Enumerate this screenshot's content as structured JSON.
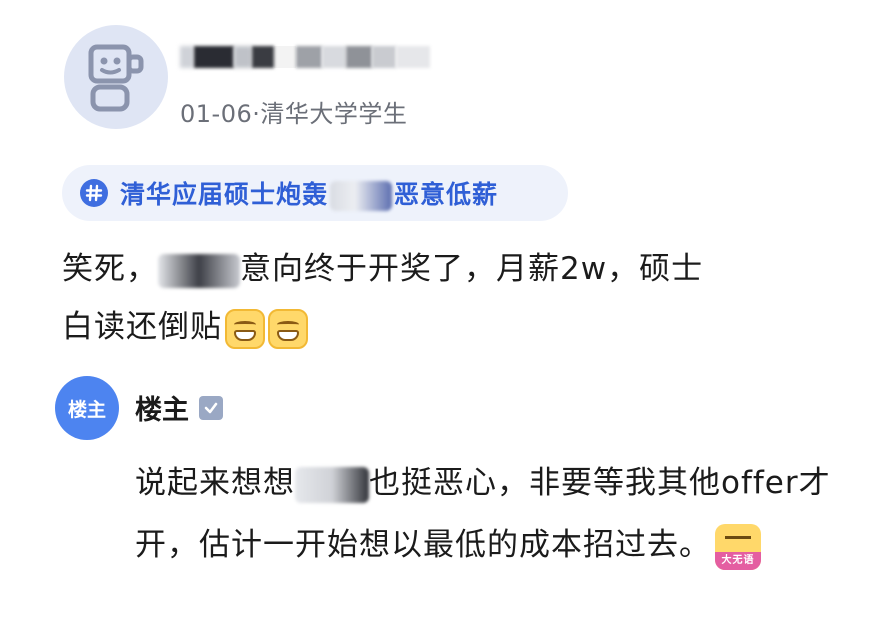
{
  "post": {
    "meta": "01-06·清华大学学生",
    "topic": {
      "hash_icon": "hashtag-icon",
      "text_start": "清华应届硕士炮轰",
      "text_end": "恶意低薪"
    },
    "body": {
      "part1": "笑死，",
      "part2": "意向终于开奖了，月薪2w，硕士",
      "line2": "白读还倒贴",
      "emoji": "grin-emoji"
    }
  },
  "reply": {
    "avatar_label": "楼主",
    "name": "楼主",
    "verified_icon": "verified-icon",
    "text_start": "说起来想想",
    "text_mid": "也挺恶心，非要等我其他offer才开，估计一开始想以最低的成本招过去。",
    "emoji_caption": "大无语"
  },
  "colors": {
    "accent": "#2f5fd6",
    "chip_bg": "#eef2fb",
    "reply_avatar": "#4d84f0",
    "meta_text": "#6b6f78"
  }
}
